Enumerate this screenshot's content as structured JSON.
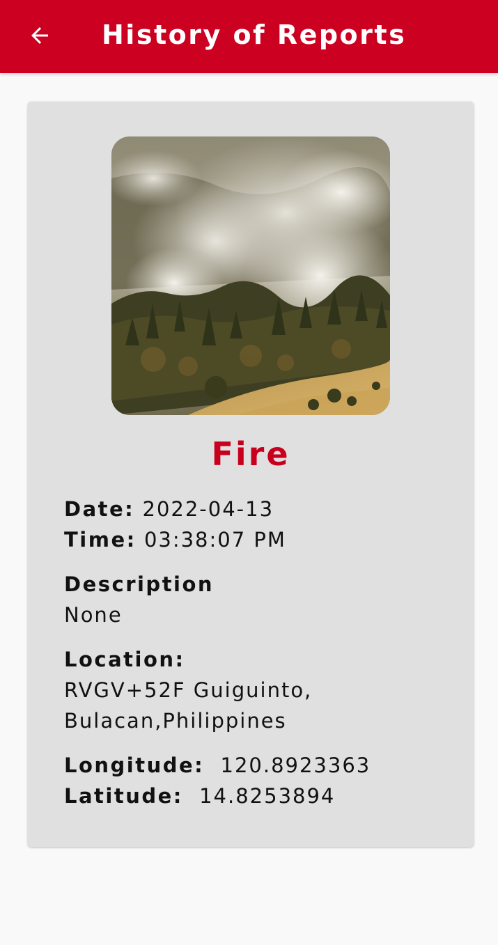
{
  "appbar": {
    "title": "History of Reports",
    "back_icon": "arrow-left-icon",
    "color": "#cc0020"
  },
  "report": {
    "photo_alt": "forest fire with smoke",
    "type": "Fire",
    "type_color": "#c8001e",
    "date_label": "Date:",
    "date": "2022-04-13",
    "time_label": "Time:",
    "time": "03:38:07 PM",
    "description_label": "Description",
    "description": "None",
    "location_label": "Location:",
    "location_line1": "RVGV+52F Guiguinto,",
    "location_line2": "Bulacan,Philippines",
    "longitude_label": "Longitude:",
    "longitude": "120.8923363",
    "latitude_label": "Latitude:",
    "latitude": "14.8253894"
  }
}
